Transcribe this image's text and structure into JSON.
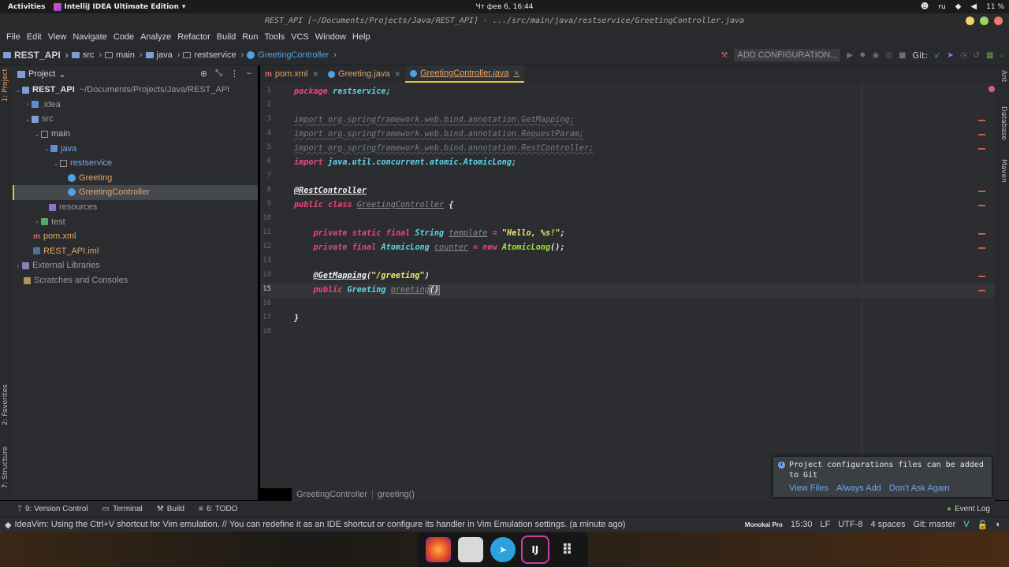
{
  "gnome": {
    "activities": "Activities",
    "app_name": "IntelliJ IDEA Ultimate Edition",
    "clock": "Чт фев 6, 16:44",
    "lang": "ru",
    "battery": "11 %"
  },
  "window": {
    "title": "REST_API [~/Documents/Projects/Java/REST_API] - .../src/main/java/restservice/GreetingController.java"
  },
  "menu": [
    "File",
    "Edit",
    "View",
    "Navigate",
    "Code",
    "Analyze",
    "Refactor",
    "Build",
    "Run",
    "Tools",
    "VCS",
    "Window",
    "Help"
  ],
  "breadcrumb": [
    "REST_API",
    "src",
    "main",
    "java",
    "restservice",
    "GreetingController"
  ],
  "toolbar": {
    "add_configuration": "ADD CONFIGURATION...",
    "git_label": "Git:"
  },
  "left_tabs": {
    "project": "1: Project",
    "favorites": "2: Favorites",
    "structure": "7: Structure"
  },
  "right_tabs": {
    "ant": "Ant",
    "database": "Database",
    "maven": "Maven"
  },
  "project_panel": {
    "title": "Project",
    "tree": [
      {
        "label": "REST_API",
        "path": "~/Documents/Projects/Java/REST_API"
      },
      {
        "label": ".idea"
      },
      {
        "label": "src"
      },
      {
        "label": "main"
      },
      {
        "label": "java"
      },
      {
        "label": "restservice"
      },
      {
        "label": "Greeting"
      },
      {
        "label": "GreetingController"
      },
      {
        "label": "resources"
      },
      {
        "label": "test"
      },
      {
        "label": "pom.xml"
      },
      {
        "label": "REST_API.iml"
      },
      {
        "label": "External Libraries"
      },
      {
        "label": "Scratches and Consoles"
      }
    ]
  },
  "tabs": [
    {
      "label": "pom.xml"
    },
    {
      "label": "Greeting.java"
    },
    {
      "label": "GreetingController.java"
    }
  ],
  "code": {
    "line_numbers": [
      "1",
      "2",
      "3",
      "4",
      "5",
      "6",
      "7",
      "8",
      "9",
      "10",
      "11",
      "12",
      "13",
      "14",
      "15",
      "16",
      "17",
      "18"
    ],
    "package_kw": "package",
    "package_name": "restservice;",
    "import1": "import org.springframework.web.bind.annotation.GetMapping;",
    "import2": "import org.springframework.web.bind.annotation.RequestParam;",
    "import3": "import org.springframework.web.bind.annotation.RestController;",
    "import4_kw": "import",
    "import4_name": "java.util.concurrent.atomic.AtomicLong;",
    "rest_annotation": "@RestController",
    "public_kw": "public",
    "class_kw": "class",
    "class_name": "GreetingController",
    "open_brace": "{",
    "private_kw": "private",
    "static_kw": "static",
    "final_kw": "final",
    "string_type": "String",
    "template_field": "template",
    "equals": "=",
    "hello_str": "\"Hello, %s!\"",
    "semicolon": ";",
    "atomiclong_type": "AtomicLong",
    "counter_field": "counter",
    "new_kw": "new",
    "atomiclong_ctor": "AtomicLong",
    "ctor_args": "();",
    "getmapping_annotation": "@GetMapping",
    "paren_open": "(",
    "greeting_path": "\"/greeting\"",
    "paren_close": ")",
    "greeting_type": "Greeting",
    "greeting_method": "greeting",
    "method_parens": "()",
    "close_brace": "}"
  },
  "editor_breadcrumb": [
    "GreetingController",
    "greeting()"
  ],
  "notification": {
    "message": "Project configurations files can be added to Git",
    "actions": [
      "View Files",
      "Always Add",
      "Don't Ask Again"
    ]
  },
  "bottom_tools": {
    "version_control": "9: Version Control",
    "terminal": "Terminal",
    "build": "Build",
    "todo": "6: TODO",
    "event_log": "Event Log"
  },
  "status": {
    "message": "IdeaVim: Using the Ctrl+V shortcut for Vim emulation. // You can redefine it as an IDE shortcut or configure its handler in Vim Emulation settings. (a minute ago)",
    "theme": "Monokai Pro",
    "position": "15:30",
    "line_sep": "LF",
    "encoding": "UTF-8",
    "indent": "4 spaces",
    "git_branch": "Git: master"
  },
  "dock": {
    "intellij": "IJ"
  },
  "colors": {
    "keyword": "#f0447a",
    "type": "#5fd4e6",
    "string": "#f2e66f",
    "link": "#6ea8e6",
    "file_modified": "#e3a66a",
    "selection_marker": "#e0c04d"
  }
}
